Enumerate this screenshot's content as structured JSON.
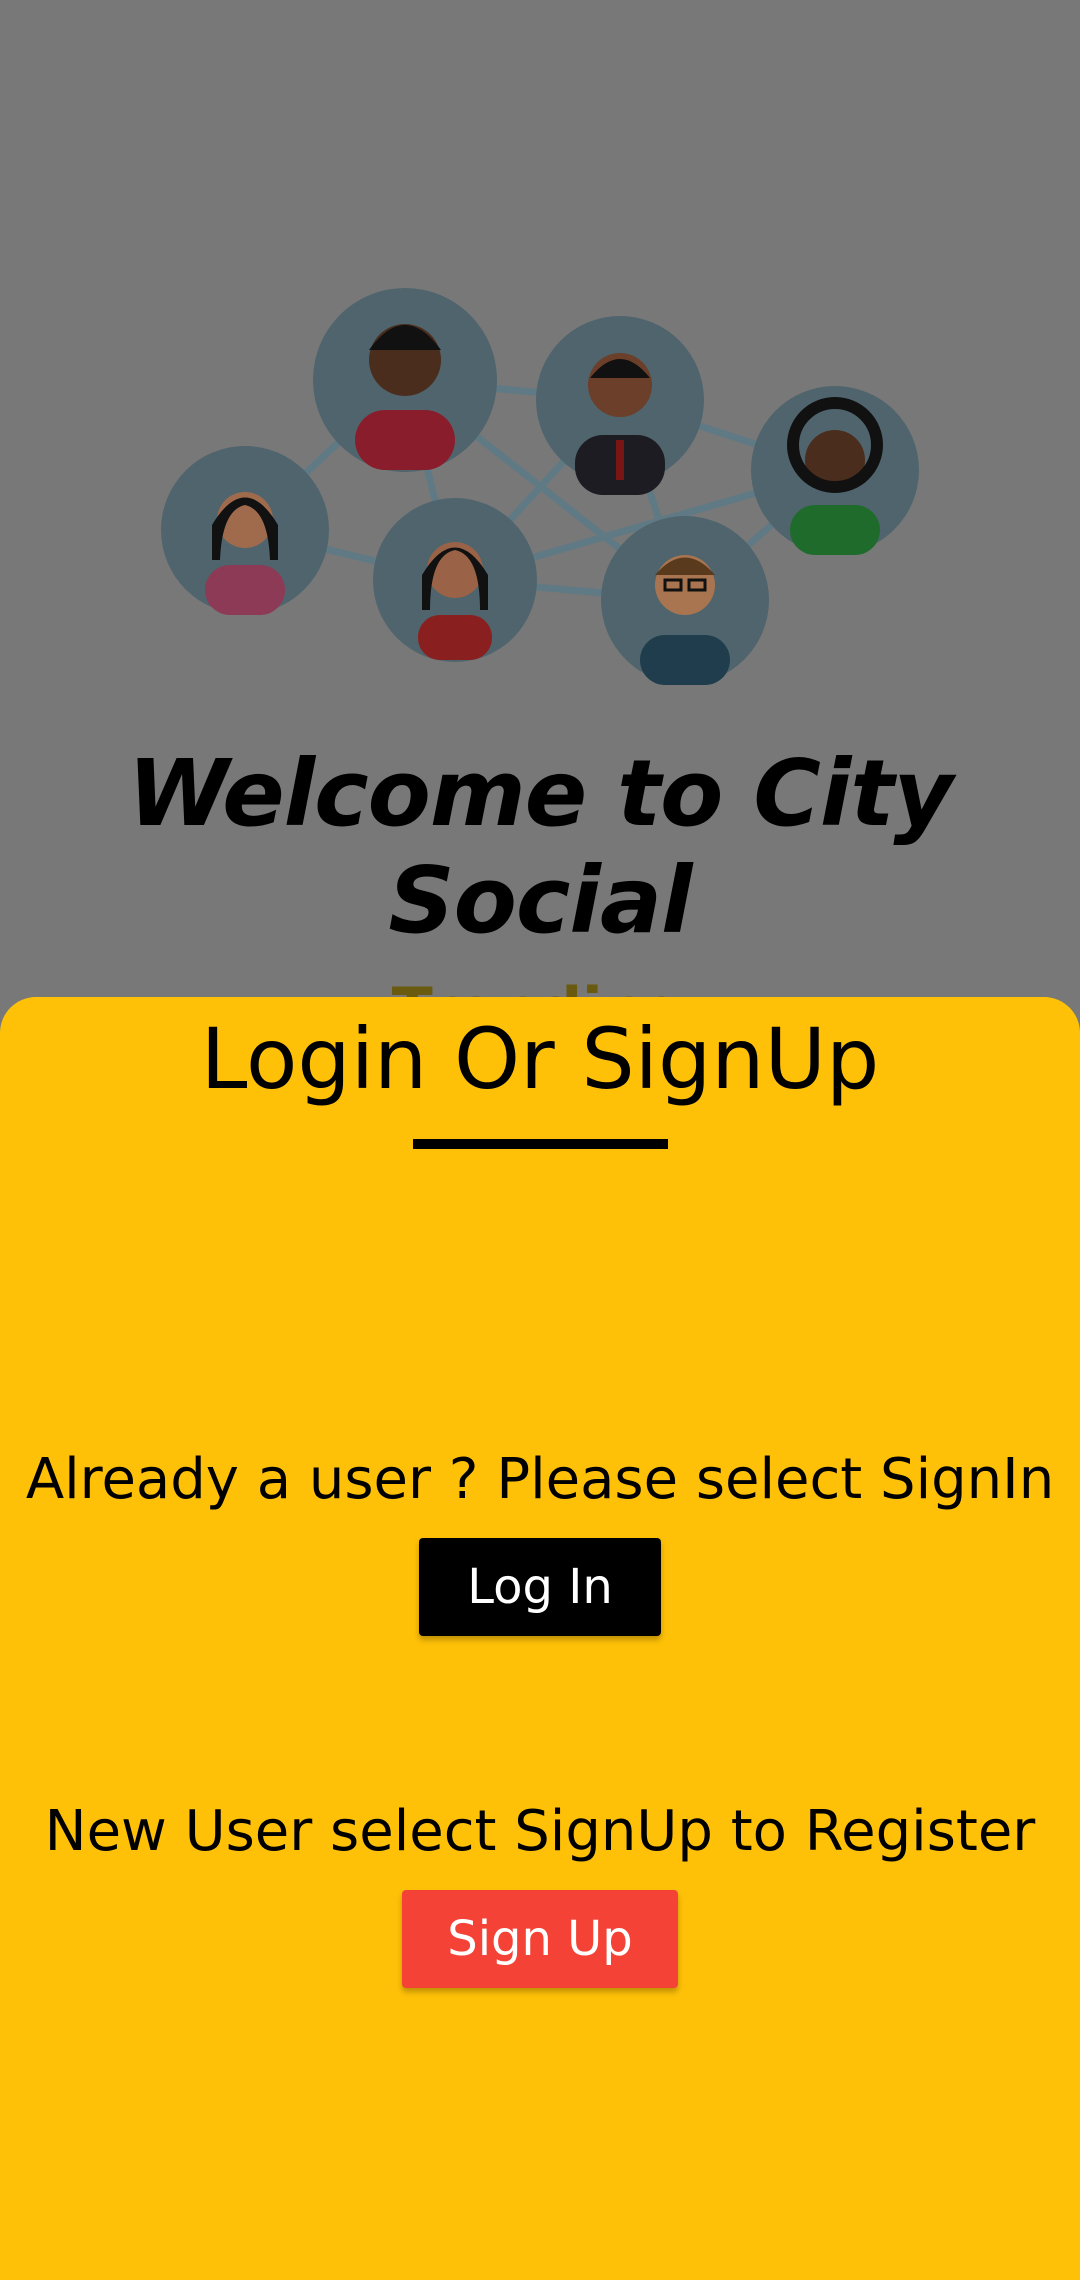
{
  "background": {
    "welcome_title": "Welcome to City Social",
    "peek_text": "Trending"
  },
  "sheet": {
    "title": "Login Or SignUp",
    "login_prompt": "Already a user ? Please select SignIn",
    "login_button": "Log In",
    "signup_prompt": "New User select SignUp to Register",
    "signup_button": "Sign Up"
  },
  "colors": {
    "sheet_background": "#FFC107",
    "login_button": "#000000",
    "signup_button": "#F44336",
    "scrim": "#787878"
  },
  "icons": {
    "illustration": "people-network-illustration"
  }
}
